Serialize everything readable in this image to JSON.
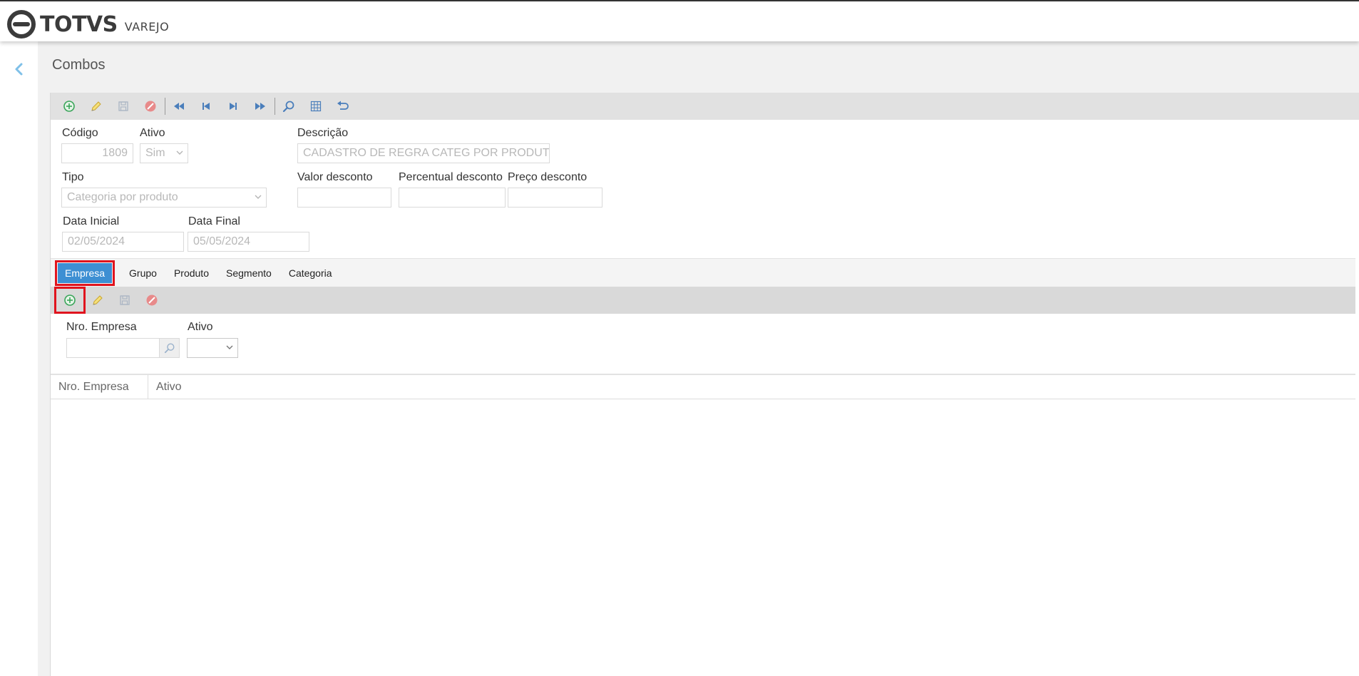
{
  "brand": {
    "name": "TOTVS",
    "product": "VAREJO"
  },
  "page": {
    "title": "Combos"
  },
  "toolbar": {
    "buttons": [
      "add-icon",
      "edit-icon",
      "save-icon",
      "cancel-icon",
      "first-record-icon",
      "previous-record-icon",
      "next-record-icon",
      "last-record-icon",
      "search-icon",
      "grid-icon",
      "undo-icon"
    ]
  },
  "form": {
    "codigo": {
      "label": "Código",
      "value": "1809"
    },
    "ativo": {
      "label": "Ativo",
      "value": "Sim"
    },
    "descricao": {
      "label": "Descrição",
      "value": "CADASTRO DE REGRA CATEG POR PRODUTO"
    },
    "tipo": {
      "label": "Tipo",
      "value": "Categoria por produto"
    },
    "valor_desconto": {
      "label": "Valor desconto",
      "value": ""
    },
    "percentual_desconto": {
      "label": "Percentual desconto",
      "value": ""
    },
    "preco_desconto": {
      "label": "Preço desconto",
      "value": ""
    },
    "data_inicial": {
      "label": "Data Inicial",
      "value": "02/05/2024"
    },
    "data_final": {
      "label": "Data Final",
      "value": "05/05/2024"
    }
  },
  "tabs": [
    {
      "label": "Empresa",
      "active": true
    },
    {
      "label": "Grupo"
    },
    {
      "label": "Produto"
    },
    {
      "label": "Segmento"
    },
    {
      "label": "Categoria"
    }
  ],
  "subform": {
    "nro_empresa": {
      "label": "Nro. Empresa",
      "value": ""
    },
    "ativo": {
      "label": "Ativo",
      "value": ""
    }
  },
  "grid": {
    "columns": [
      "Nro. Empresa",
      "Ativo"
    ],
    "rows": []
  },
  "colors": {
    "accent": "#3d8fd3",
    "highlight": "#e0141e",
    "add": "#3aa55a",
    "edit": "#e3c23a",
    "cancel": "#d9534f",
    "nav": "#4a7ebb"
  }
}
